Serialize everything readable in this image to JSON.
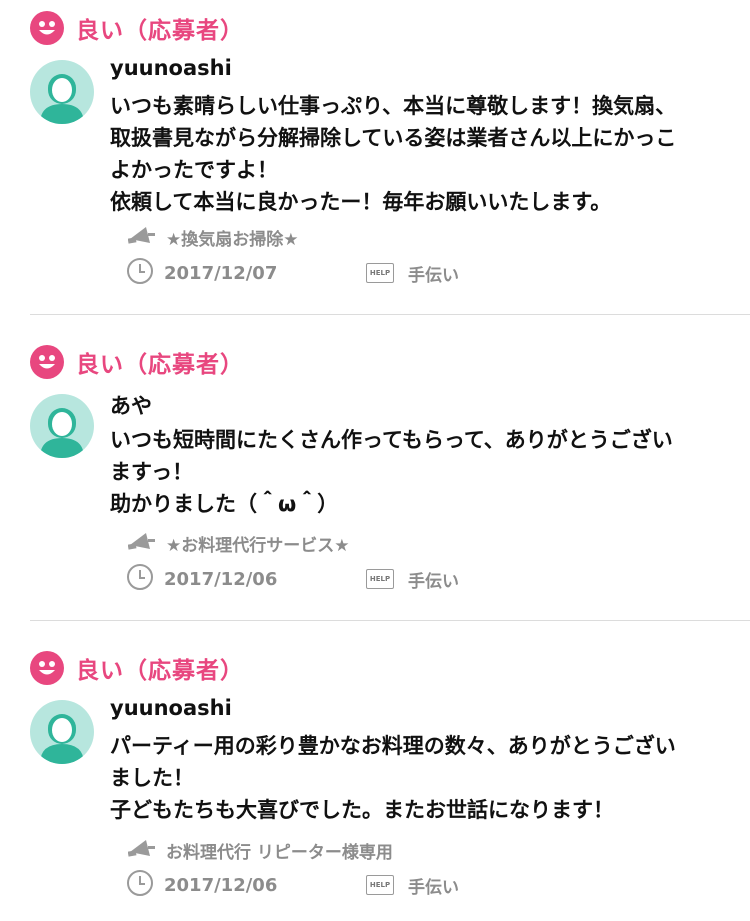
{
  "reviews": [
    {
      "rating_label": "良い（応募者）",
      "user": "yuunoashi",
      "comment": "いつも素晴らしい仕事っぷり、本当に尊敬します！換気扇、\n取扱書見ながら分解掃除している姿は業者さん以上にかっこ\nよかったですよ！\n依頼して本当に良かったー！毎年お願いいたします。",
      "service": "★換気扇お掃除★",
      "date": "2017/12/07",
      "help_label": "手伝い"
    },
    {
      "rating_label": "良い（応募者）",
      "user": "あや",
      "comment": "いつも短時間にたくさん作ってもらって、ありがとうござい\nますっ！\n助かりました（＾ω＾）",
      "service": "★お料理代行サービス★",
      "date": "2017/12/06",
      "help_label": "手伝い"
    },
    {
      "rating_label": "良い（応募者）",
      "user": "yuunoashi",
      "comment": "パーティー用の彩り豊かなお料理の数々、ありがとうござい\nました！\n子どもたちも大喜びでした。またお世話になります！",
      "service": "お料理代行 リピーター様専用",
      "date": "2017/12/06",
      "help_label": "手伝い"
    }
  ],
  "help_badge": "HELP",
  "colors": {
    "accent": "#e8477f",
    "avatar_bg": "#b7e6de",
    "avatar_body": "#2fb59a",
    "meta_text": "#8c8c8c"
  },
  "icons": {
    "rating": "smiley-icon",
    "service": "megaphone-icon",
    "date": "clock-icon",
    "help": "help-icon"
  }
}
